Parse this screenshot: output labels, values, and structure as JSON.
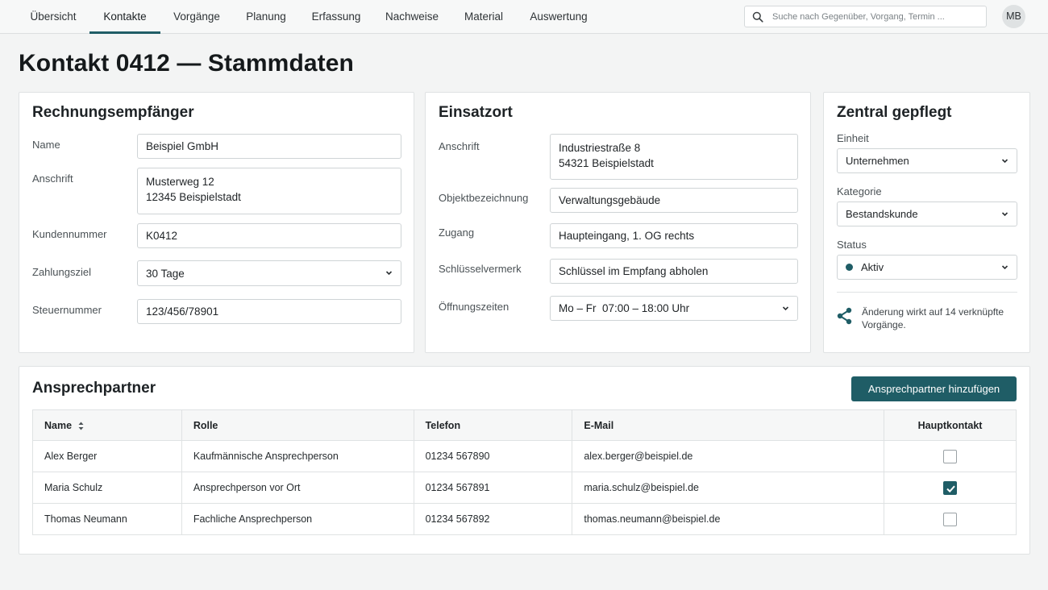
{
  "nav": {
    "tabs": [
      {
        "label": "Übersicht"
      },
      {
        "label": "Kontakte",
        "active": true
      },
      {
        "label": "Vorgänge"
      },
      {
        "label": "Planung"
      },
      {
        "label": "Erfassung"
      },
      {
        "label": "Nachweise"
      },
      {
        "label": "Material"
      },
      {
        "label": "Auswertung"
      }
    ],
    "search_placeholder": "Suche nach Gegenüber, Vorgang, Termin ...",
    "avatar": "MB"
  },
  "page_title": "Kontakt 0412 — Stammdaten",
  "billing": {
    "title": "Rechnungsempfänger",
    "name_label": "Name",
    "name": "Beispiel GmbH",
    "address_label": "Anschrift",
    "address_line1": "Musterweg 12",
    "address_line2": "12345 Beispielstadt",
    "customer_no_label": "Kundennummer",
    "customer_no": "K0412",
    "payment_label": "Zahlungsziel",
    "payment": "30 Tage",
    "tax_label": "Steuernummer",
    "tax_no": "123/456/78901"
  },
  "site": {
    "title": "Einsatzort",
    "address_label": "Anschrift",
    "address_line1": "Industriestraße 8",
    "address_line2": "54321 Beispielstadt",
    "object_label": "Objektbezeichnung",
    "object": "Verwaltungsgebäude",
    "access_label": "Zugang",
    "access": "Haupteingang, 1. OG rechts",
    "key_label": "Schlüsselvermerk",
    "key_note": "Schlüssel im Empfang abholen",
    "hours_label": "Öffnungszeiten",
    "hours": "Mo – Fr  07:00 – 18:00 Uhr"
  },
  "central": {
    "title": "Zentral gepflegt",
    "unit_label": "Einheit",
    "unit": "Unternehmen",
    "category_label": "Kategorie",
    "category": "Bestandskunde",
    "status_label": "Status",
    "status": "Aktiv",
    "status_color": "#1f5d66",
    "notice": "Änderung wirkt auf 14 verknüpfte Vorgänge."
  },
  "contacts": {
    "title": "Ansprechpartner",
    "add_button": "Ansprechpartner hinzufügen",
    "columns": [
      "Name",
      "Rolle",
      "Telefon",
      "E-Mail",
      "Hauptkontakt"
    ],
    "rows": [
      {
        "name": "Alex Berger",
        "role": "Kaufmännische Ansprechperson",
        "phone": "01234 567890",
        "email": "alex.berger@beispiel.de",
        "primary": false
      },
      {
        "name": "Maria Schulz",
        "role": "Ansprechperson vor Ort",
        "phone": "01234 567891",
        "email": "maria.schulz@beispiel.de",
        "primary": true
      },
      {
        "name": "Thomas Neumann",
        "role": "Fachliche Ansprechperson",
        "phone": "01234 567892",
        "email": "thomas.neumann@beispiel.de",
        "primary": false
      }
    ]
  },
  "colors": {
    "accent": "#1f5d66"
  }
}
